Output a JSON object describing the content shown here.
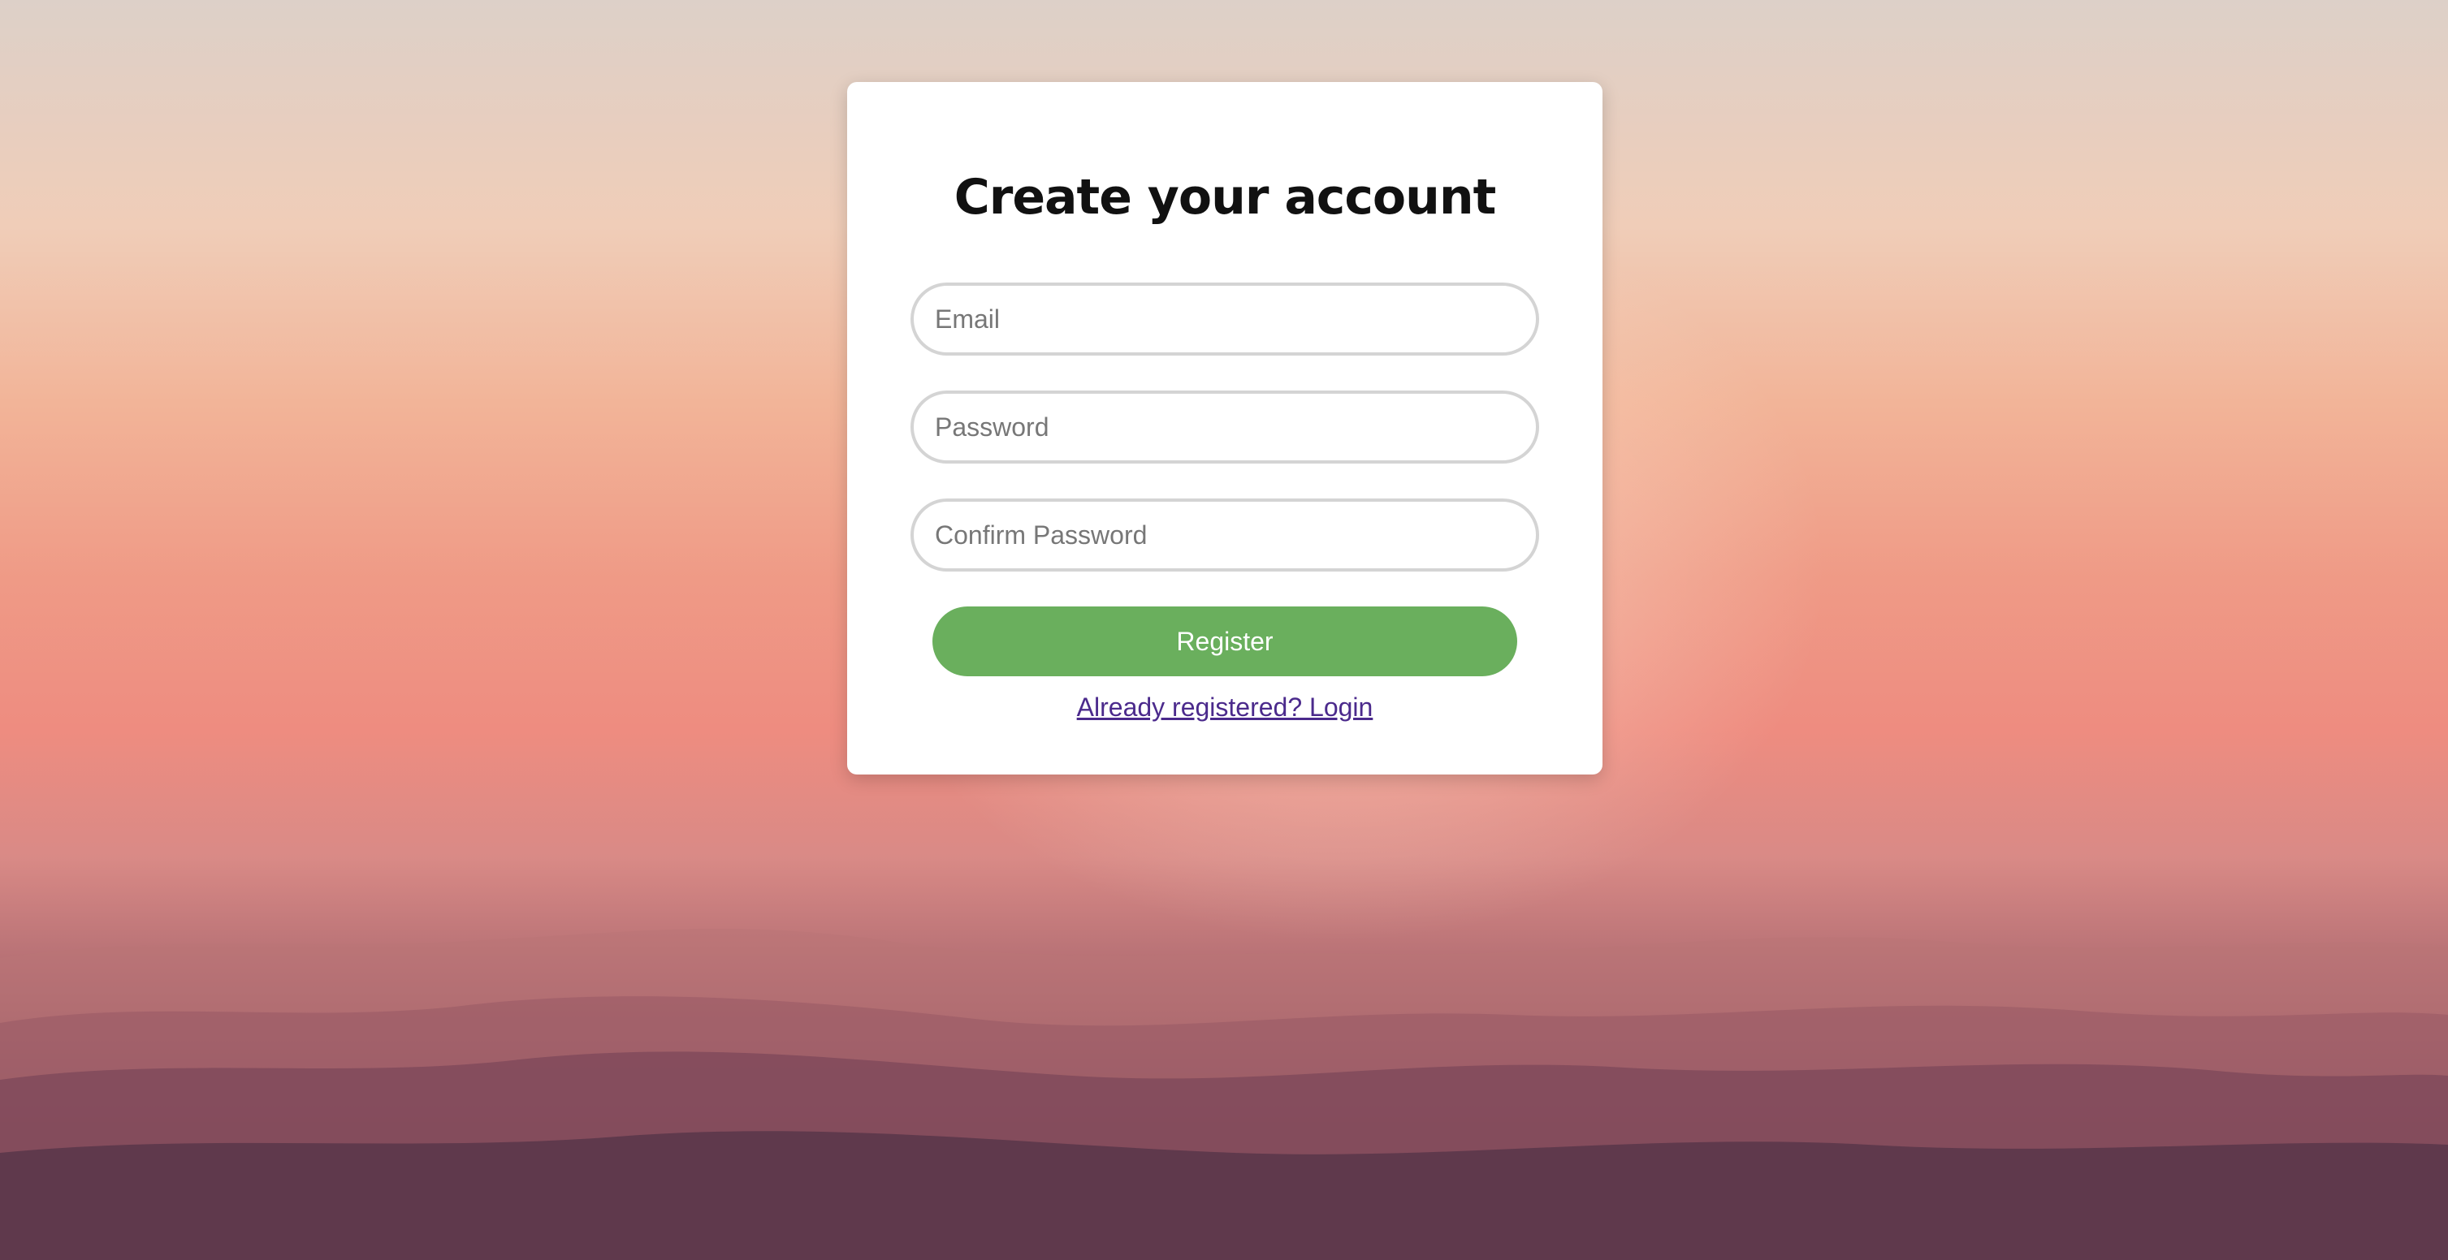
{
  "form": {
    "title": "Create your account",
    "email_placeholder": "Email",
    "password_placeholder": "Password",
    "confirm_password_placeholder": "Confirm Password",
    "register_label": "Register",
    "login_link_label": "Already registered? Login"
  },
  "colors": {
    "register_button": "#6aaf5d",
    "link": "#4b2a8c",
    "card": "#ffffff"
  }
}
